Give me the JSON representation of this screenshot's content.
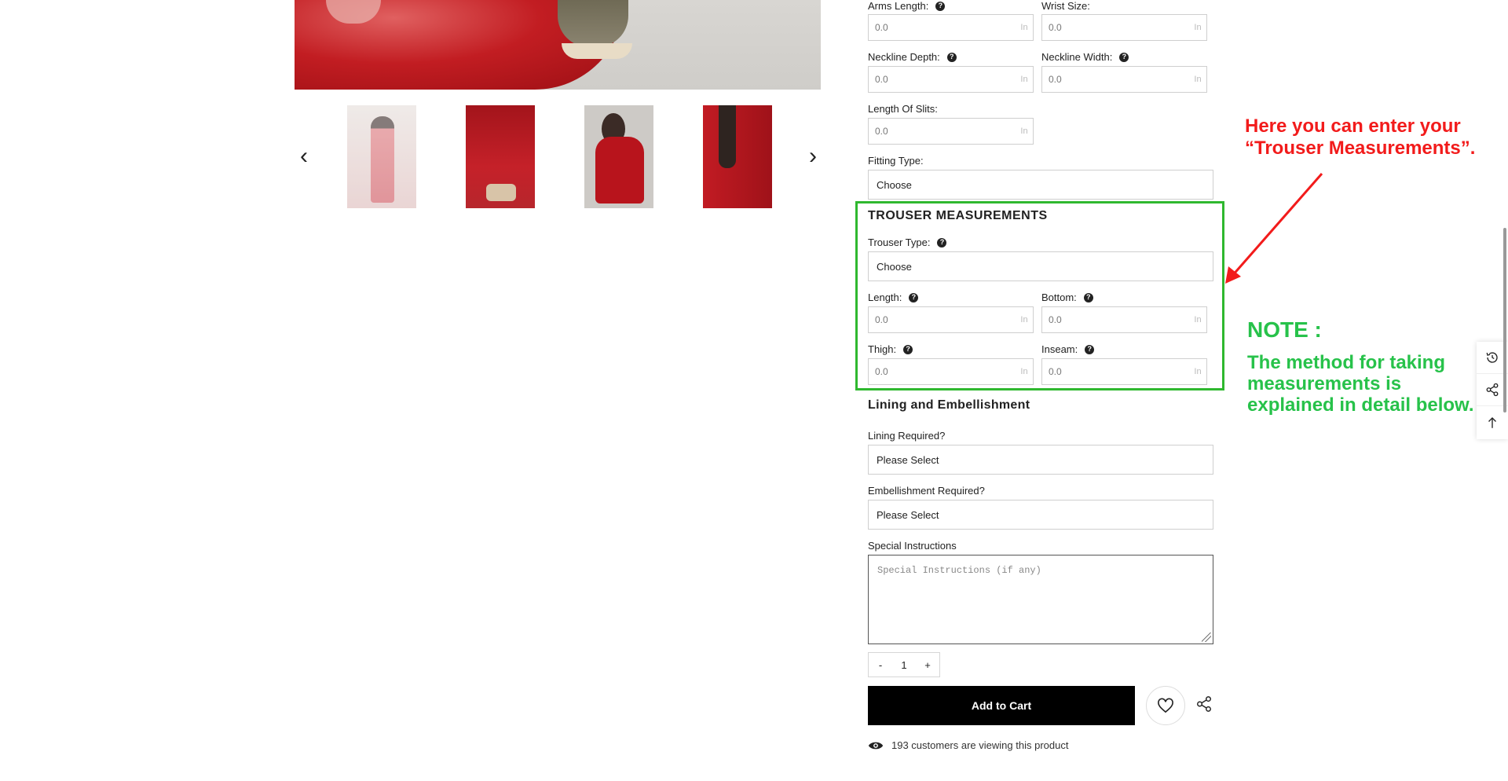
{
  "gallery": {
    "prev_arrow": "‹",
    "next_arrow": "›"
  },
  "fields": {
    "arms_length": {
      "label": "Arms Length:",
      "value": "0.0",
      "unit": "In"
    },
    "wrist_size": {
      "label": "Wrist Size:",
      "value": "0.0",
      "unit": "In"
    },
    "neckline_depth": {
      "label": "Neckline Depth:",
      "value": "0.0",
      "unit": "In"
    },
    "neckline_width": {
      "label": "Neckline Width:",
      "value": "0.0",
      "unit": "In"
    },
    "length_of_slits": {
      "label": "Length Of Slits:",
      "value": "0.0",
      "unit": "In"
    },
    "fitting_type": {
      "label": "Fitting Type:",
      "value": "Choose"
    }
  },
  "trouser": {
    "title": "TROUSER MEASUREMENTS",
    "type": {
      "label": "Trouser Type:",
      "value": "Choose"
    },
    "length": {
      "label": "Length:",
      "value": "0.0",
      "unit": "In"
    },
    "bottom": {
      "label": "Bottom:",
      "value": "0.0",
      "unit": "In"
    },
    "thigh": {
      "label": "Thigh:",
      "value": "0.0",
      "unit": "In"
    },
    "inseam": {
      "label": "Inseam:",
      "value": "0.0",
      "unit": "In"
    }
  },
  "lining": {
    "title": "Lining and Embellishment",
    "lining_label": "Lining Required?",
    "lining_value": "Please Select",
    "embellishment_label": "Embellishment Required?",
    "embellishment_value": "Please Select"
  },
  "special": {
    "label": "Special Instructions",
    "placeholder": "Special Instructions (if any)"
  },
  "cart": {
    "minus": "-",
    "quantity": "1",
    "plus": "+",
    "add_to_cart": "Add to Cart",
    "viewing": "193 customers are viewing this product"
  },
  "annotations": {
    "red_note": "Here you can enter your\n“Trouser Measurements”.",
    "green_title": "NOTE :",
    "green_body": "The method for taking\nmeasurements is\nexplained in detail below."
  },
  "colors": {
    "annotation_red": "#f21b1b",
    "annotation_green": "#27c24a",
    "highlight_box": "#2fb82f"
  }
}
